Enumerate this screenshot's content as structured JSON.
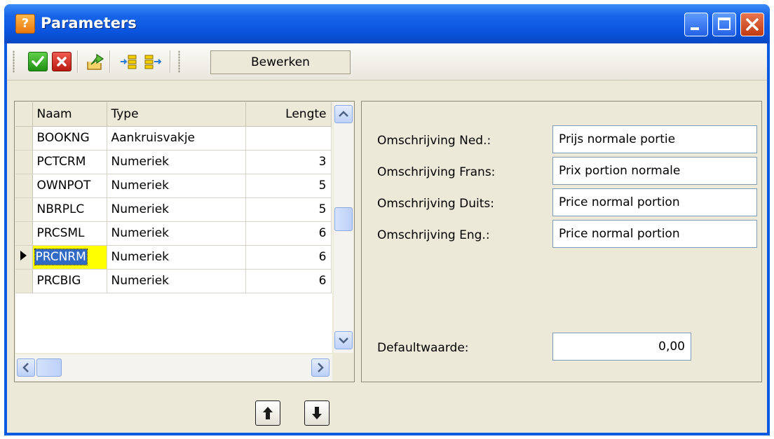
{
  "window": {
    "title": "Parameters",
    "title_icon": "help-question-icon"
  },
  "toolbar": {
    "icons": [
      "confirm-check-icon",
      "cancel-cross-icon",
      "export-arrow-icon",
      "insert-left-icon",
      "insert-right-icon"
    ],
    "edit_label": "Bewerken"
  },
  "grid": {
    "columns": [
      "Naam",
      "Type",
      "Lengte"
    ],
    "rows": [
      {
        "naam": "BOOKNG",
        "type": "Aankruisvakje",
        "lengte": ""
      },
      {
        "naam": "PCTCRM",
        "type": "Numeriek",
        "lengte": "3"
      },
      {
        "naam": "OWNPOT",
        "type": "Numeriek",
        "lengte": "5"
      },
      {
        "naam": "NBRPLC",
        "type": "Numeriek",
        "lengte": "5"
      },
      {
        "naam": "PRCSML",
        "type": "Numeriek",
        "lengte": "6"
      },
      {
        "naam": "PRCNRM",
        "type": "Numeriek",
        "lengte": "6"
      },
      {
        "naam": "PRCBIG",
        "type": "Numeriek",
        "lengte": "6"
      }
    ],
    "selected_row_index": 5
  },
  "details": {
    "fields": [
      {
        "label": "Omschrijving Ned.:",
        "value": "Prijs normale portie"
      },
      {
        "label": "Omschrijving Frans:",
        "value": "Prix portion normale"
      },
      {
        "label": "Omschrijving Duits:",
        "value": "Price normal portion"
      },
      {
        "label": "Omschrijving Eng.:",
        "value": "Price normal portion"
      }
    ],
    "default": {
      "label": "Defaultwaarde:",
      "value": "0,00"
    }
  },
  "colors": {
    "title_bar": "#0a54de",
    "client_bg": "#ece9d8",
    "selection": "#316ac5",
    "selected_cell_bg": "#ffff00"
  }
}
